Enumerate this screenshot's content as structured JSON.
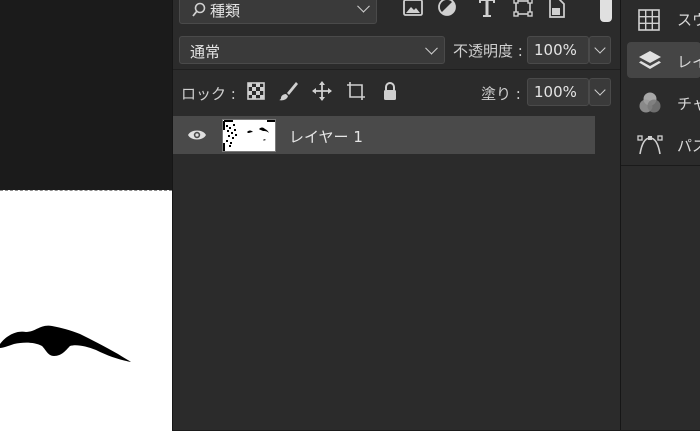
{
  "layers_panel": {
    "kind_filter": {
      "search_icon": "search-icon",
      "value": "種類"
    },
    "filter_icons": [
      "image-filter-icon",
      "adjustment-filter-icon",
      "type-filter-icon",
      "shape-filter-icon",
      "smart-object-filter-icon"
    ],
    "blend_mode": "通常",
    "opacity": {
      "label": "不透明度 :",
      "value": "100%"
    },
    "lock": {
      "label": "ロック :",
      "icons": [
        "lock-transparent-icon",
        "lock-image-icon",
        "lock-position-icon",
        "lock-artboard-icon",
        "lock-all-icon"
      ]
    },
    "fill": {
      "label": "塗り :",
      "value": "100%"
    },
    "layers": [
      {
        "name": "レイヤー 1",
        "visible": true,
        "selected": true
      }
    ]
  },
  "right_dock": {
    "items": [
      {
        "label": "スウ",
        "icon": "swatches-icon"
      },
      {
        "label": "レイ",
        "icon": "layers-icon",
        "active": true
      },
      {
        "label": "チャ",
        "icon": "channels-icon"
      },
      {
        "label": "パス",
        "icon": "paths-icon"
      }
    ]
  },
  "colors": {
    "panel_bg": "#2b2b2b",
    "canvas_bg": "#1b1b1b",
    "selected_row": "#4a4a4a"
  }
}
